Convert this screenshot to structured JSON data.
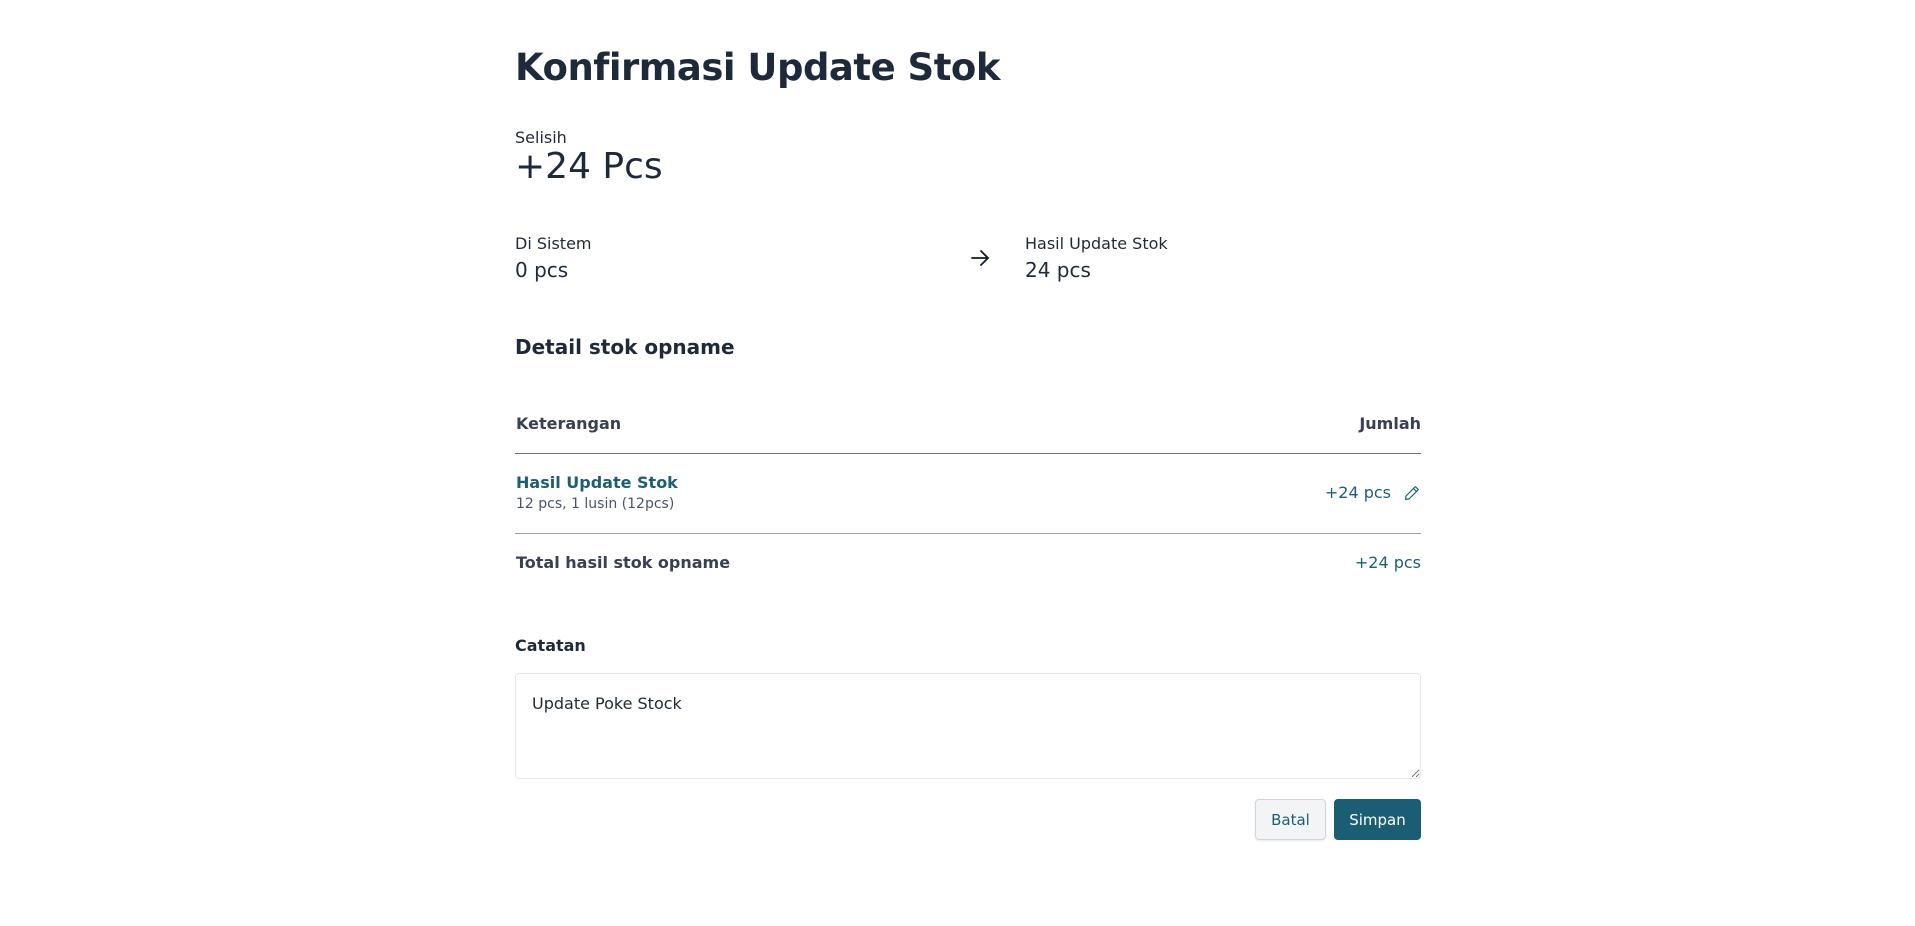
{
  "page": {
    "title": "Konfirmasi Update Stok"
  },
  "difference": {
    "label": "Selisih",
    "value": "+24 Pcs"
  },
  "comparison": {
    "system_label": "Di Sistem",
    "system_value": "0 pcs",
    "arrow_icon": "arrow-right-icon",
    "result_label": "Hasil Update Stok",
    "result_value": "24 pcs"
  },
  "detail": {
    "section_title": "Detail stok opname",
    "columns": {
      "description": "Keterangan",
      "amount": "Jumlah"
    },
    "rows": [
      {
        "title": "Hasil Update Stok",
        "subtitle": "12 pcs, 1 lusin (12pcs)",
        "amount": "+24 pcs",
        "action_icon": "pencil-edit-icon"
      }
    ],
    "total_label": "Total hasil stok opname",
    "total_value": "+24 pcs"
  },
  "notes": {
    "label": "Catatan",
    "value": "Update Poke Stock"
  },
  "actions": {
    "cancel_label": "Batal",
    "save_label": "Simpan"
  },
  "colors": {
    "primary": "#1b5e73",
    "link": "#1d5e74",
    "heading": "#1e2a3a"
  }
}
